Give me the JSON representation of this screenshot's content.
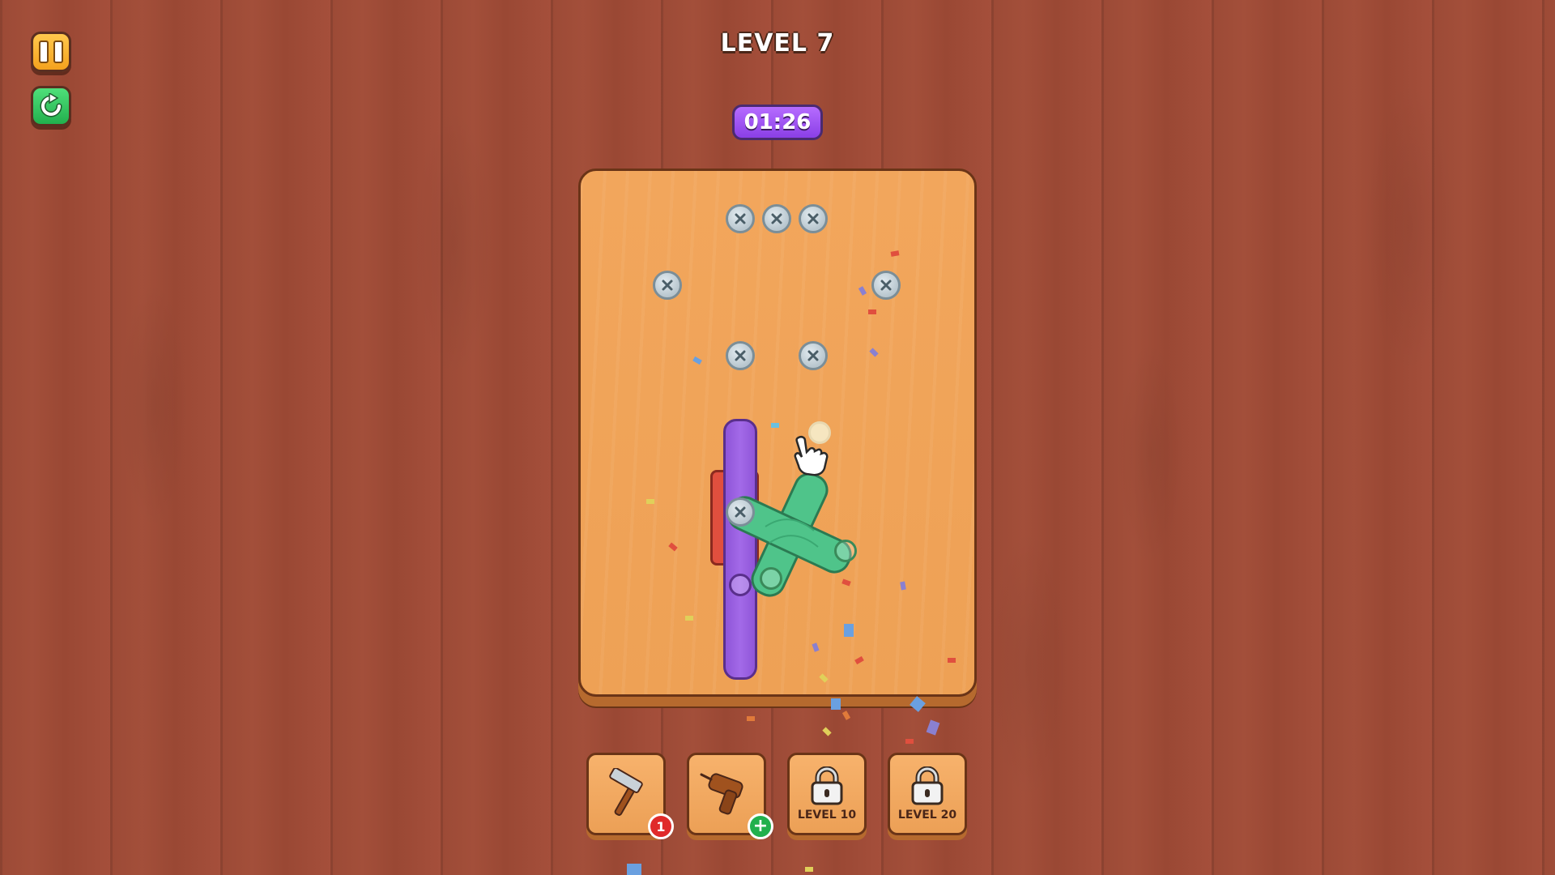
{
  "hud": {
    "level_title": "LEVEL 7",
    "timer": "01:26",
    "pause_icon": "pause-icon",
    "restart_icon": "restart-icon"
  },
  "colors": {
    "table_wood": "#a34f3a",
    "board_wood": "#f2a65c",
    "timer_purple": "#9a50ef",
    "pause_orange": "#f4a21d",
    "restart_green": "#22b04d",
    "plank_purple": "#a36ae8",
    "plank_green": "#4fc48a",
    "plank_red": "#e04f3e"
  },
  "toolbar": {
    "tools": [
      {
        "name": "hammer",
        "icon": "hammer-icon",
        "badge": "1"
      },
      {
        "name": "drill",
        "icon": "drill-icon",
        "badge_icon": "plus-icon"
      },
      {
        "name": "locked-tool",
        "icon": "lock-icon",
        "label": "LEVEL 10"
      },
      {
        "name": "locked-tool",
        "icon": "lock-icon",
        "label": "LEVEL 20"
      }
    ]
  }
}
